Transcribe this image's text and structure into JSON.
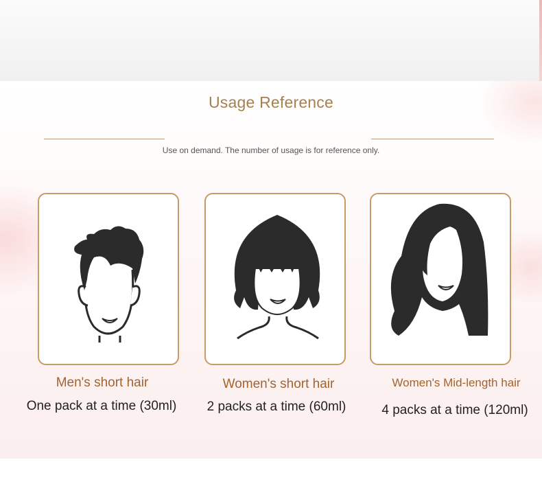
{
  "section": {
    "title": "Usage Reference",
    "subtitle": "Use on demand. The number of usage is for reference only."
  },
  "cards": [
    {
      "label": "Men's short hair",
      "amount": "One pack at a time (30ml)",
      "icon": "men-short-hair-icon"
    },
    {
      "label": "Women's short hair",
      "amount": "2 packs at a time (60ml)",
      "icon": "women-short-hair-icon"
    },
    {
      "label": "Women's Mid-length hair",
      "amount": "4 packs at a time (120ml)",
      "icon": "women-mid-length-hair-icon"
    }
  ],
  "colors": {
    "accent_gold": "#c89a65",
    "title": "#a78050",
    "label": "#a3632f",
    "hair": "#2b2b2b"
  }
}
